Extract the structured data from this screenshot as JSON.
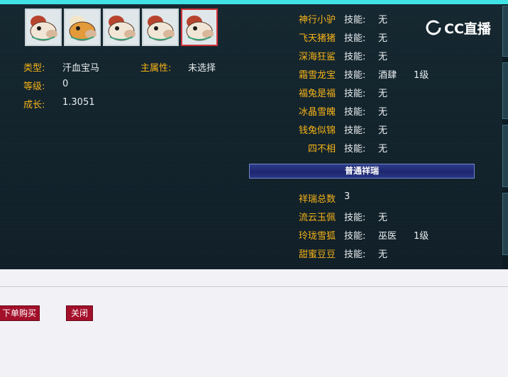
{
  "pets": [
    {
      "name": "horse-portrait",
      "selected": false
    },
    {
      "name": "sheep-portrait",
      "selected": false
    },
    {
      "name": "horse-portrait",
      "selected": false
    },
    {
      "name": "horse-portrait",
      "selected": false
    },
    {
      "name": "horse-portrait",
      "selected": true
    }
  ],
  "info": {
    "type_label": "类型:",
    "type_value": "汗血宝马",
    "attr_label": "主属性:",
    "attr_value": "未选择",
    "level_label": "等级:",
    "level_value": "0",
    "growth_label": "成长:",
    "growth_value": "1.3051"
  },
  "skill_tag": "技能:",
  "skills": [
    {
      "name": "神行小驴",
      "value": "无",
      "level": ""
    },
    {
      "name": "飞天猪猪",
      "value": "无",
      "level": ""
    },
    {
      "name": "深海狂鲨",
      "value": "无",
      "level": ""
    },
    {
      "name": "霜雪龙宝",
      "value": "酒肆",
      "level": "1级"
    },
    {
      "name": "福兔是福",
      "value": "无",
      "level": ""
    },
    {
      "name": "冰晶雪魄",
      "value": "无",
      "level": ""
    },
    {
      "name": "钱兔似锦",
      "value": "无",
      "level": ""
    },
    {
      "name": "四不相",
      "value": "无",
      "level": ""
    }
  ],
  "xiangrui_title": "普通祥瑞",
  "xiangrui_total_label": "祥瑞总数",
  "xiangrui_total_value": "3",
  "xiangrui": [
    {
      "name": "流云玉佩",
      "value": "无",
      "level": ""
    },
    {
      "name": "玲珑雪狐",
      "value": "巫医",
      "level": "1级"
    },
    {
      "name": "甜蜜豆豆",
      "value": "无",
      "level": ""
    }
  ],
  "watermark": "CC直播",
  "buttons": {
    "buy": "下单购买",
    "close": "关闭"
  },
  "colors": {
    "accent": "#f5b318",
    "panel": "#14262f",
    "button": "#a3102a",
    "top_bar": "#3fe3e6"
  }
}
